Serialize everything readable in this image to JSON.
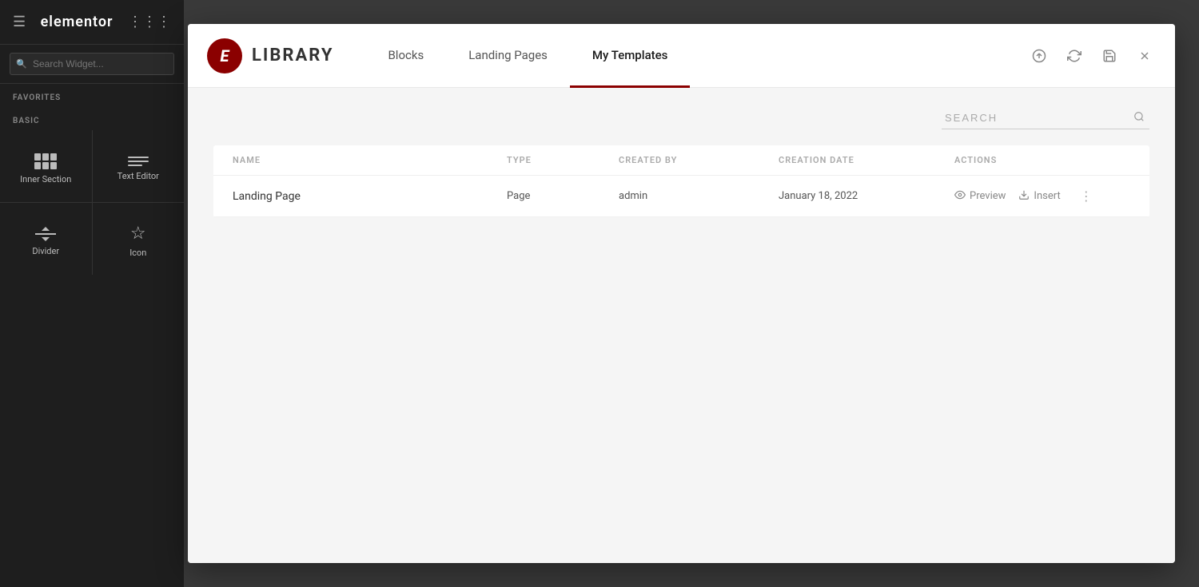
{
  "editor": {
    "logo_text": "elementor",
    "sidebar": {
      "search_placeholder": "Search Widget...",
      "sections": [
        {
          "label": "FAVORITES",
          "widgets": []
        },
        {
          "label": "BASIC",
          "widgets": [
            {
              "id": "inner-section",
              "label": "Inner Section",
              "icon_type": "inner-section"
            },
            {
              "id": "text-editor",
              "label": "Text Editor",
              "icon_type": "text-editor"
            },
            {
              "id": "divider",
              "label": "Divider",
              "icon_type": "divider"
            },
            {
              "id": "icon",
              "label": "Icon",
              "icon_type": "star"
            }
          ]
        }
      ]
    }
  },
  "library": {
    "title": "LIBRARY",
    "tabs": [
      {
        "id": "blocks",
        "label": "Blocks",
        "active": false
      },
      {
        "id": "landing-pages",
        "label": "Landing Pages",
        "active": false
      },
      {
        "id": "my-templates",
        "label": "My Templates",
        "active": true
      }
    ],
    "search_placeholder": "SEARCH",
    "table": {
      "headers": [
        {
          "id": "name",
          "label": "NAME"
        },
        {
          "id": "type",
          "label": "TYPE"
        },
        {
          "id": "created-by",
          "label": "CREATED BY"
        },
        {
          "id": "creation-date",
          "label": "CREATION DATE"
        },
        {
          "id": "actions",
          "label": "ACTIONS"
        }
      ],
      "rows": [
        {
          "name": "Landing Page",
          "type": "Page",
          "created_by": "admin",
          "creation_date": "January 18, 2022",
          "actions": {
            "preview_label": "Preview",
            "insert_label": "Insert"
          }
        }
      ]
    }
  }
}
